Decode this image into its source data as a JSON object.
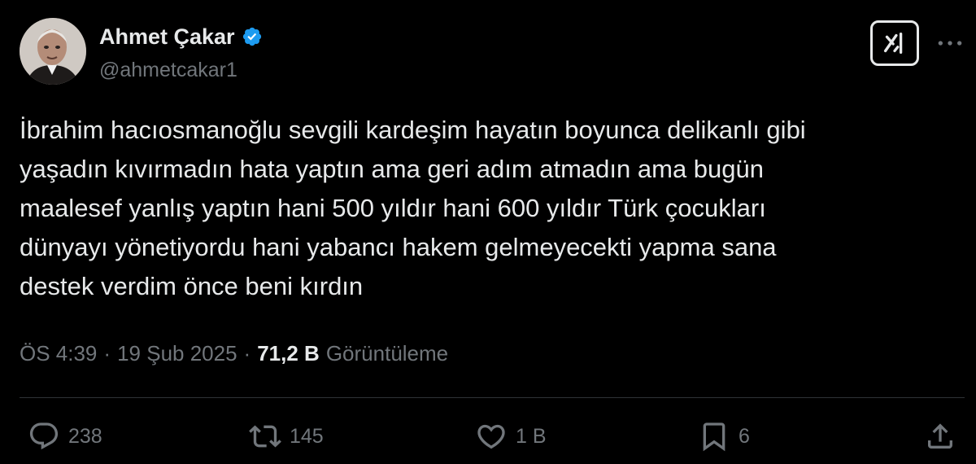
{
  "author": {
    "display_name": "Ahmet Çakar",
    "handle": "@ahmetcakar1",
    "verified": true
  },
  "tweet": {
    "text": "İbrahim hacıosmanoğlu sevgili kardeşim hayatın boyunca delikanlı gibi\nyaşadın kıvırmadın hata yaptın ama geri adım atmadın ama bugün\nmaalesef yanlış yaptın hani 500 yıldır hani 600 yıldır Türk çocukları\ndünyayı yönetiyordu hani yabancı hakem gelmeyecekti yapma sana\ndestek verdim önce beni kırdın",
    "time": "ÖS 4:39",
    "separator": "·",
    "date": "19 Şub 2025",
    "views_count": "71,2 B",
    "views_label": "Görüntüleme"
  },
  "actions": {
    "replies": "238",
    "reposts": "145",
    "likes": "1 B",
    "bookmarks": "6"
  },
  "icons": {
    "verified": "verified-badge-icon",
    "grok": "grok-icon",
    "more": "more-horizontal-icon",
    "reply": "reply-icon",
    "repost": "repost-icon",
    "like": "heart-icon",
    "bookmark": "bookmark-icon",
    "share": "share-icon"
  },
  "colors": {
    "background": "#000000",
    "text_primary": "#e7e9ea",
    "text_secondary": "#71767b",
    "verified_blue": "#1d9bf0",
    "divider": "#2f3336"
  }
}
